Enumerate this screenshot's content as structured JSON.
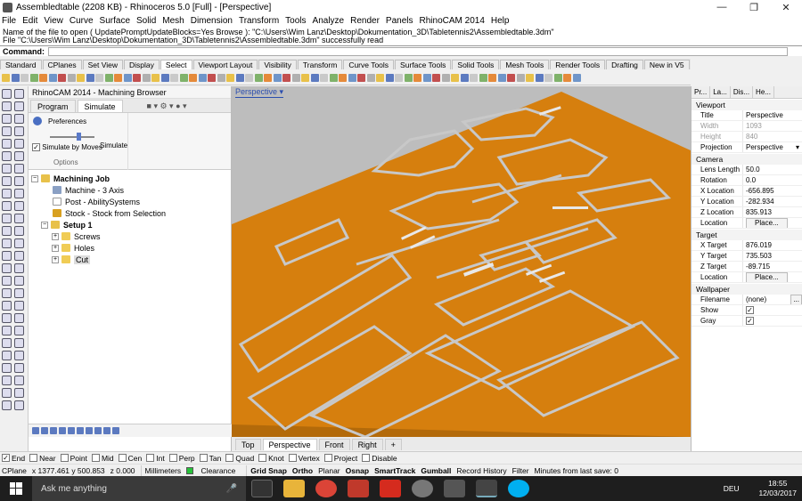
{
  "window": {
    "title": "Assembledtable (2208 KB) - Rhinoceros 5.0 [Full] - [Perspective]"
  },
  "menu": [
    "File",
    "Edit",
    "View",
    "Curve",
    "Surface",
    "Solid",
    "Mesh",
    "Dimension",
    "Transform",
    "Tools",
    "Analyze",
    "Render",
    "Panels",
    "RhinoCAM 2014",
    "Help"
  ],
  "command_history": [
    "Name of the file to open ( UpdatePromptUpdateBlocks=Yes  Browse ): \"C:\\Users\\Wim Lanz\\Desktop\\Dokumentation_3D\\Tabletennis2\\Assembledtable.3dm\"",
    "File \"C:\\Users\\Wim Lanz\\Desktop\\Dokumentation_3D\\Tabletennis2\\Assembledtable.3dm\" successfully read"
  ],
  "command_label": "Command:",
  "toolbar_tabs": [
    "Standard",
    "CPlanes",
    "Set View",
    "Display",
    "Select",
    "Viewport Layout",
    "Visibility",
    "Transform",
    "Curve Tools",
    "Surface Tools",
    "Solid Tools",
    "Mesh Tools",
    "Render Tools",
    "Drafting",
    "New in V5"
  ],
  "active_toolbar_tab": "Select",
  "browser": {
    "title": "RhinoCAM 2014 - Machining Browser",
    "tabs": [
      "Program",
      "Simulate"
    ],
    "preferences_label": "Preferences",
    "simulate_by_moves": "Simulate by Moves",
    "options_label": "Options",
    "simulate_label": "Simulate",
    "tree": {
      "job": "Machining Job",
      "machine": "Machine - 3 Axis",
      "post": "Post - AbilitySystems",
      "stock": "Stock - Stock from Selection",
      "setup": "Setup 1",
      "folders": [
        "Screws",
        "Holes",
        "Cut"
      ]
    }
  },
  "viewport": {
    "label": "Perspective",
    "tabs": [
      "Top",
      "Perspective",
      "Front",
      "Right",
      "+"
    ],
    "active_tab": "Perspective"
  },
  "properties": {
    "tabs": [
      "Pr...",
      "La...",
      "Dis...",
      "He..."
    ],
    "viewport_section": "Viewport",
    "title_label": "Title",
    "title_value": "Perspective",
    "width_label": "Width",
    "width_value": "1093",
    "height_label": "Height",
    "height_value": "840",
    "projection_label": "Projection",
    "projection_value": "Perspective",
    "camera_section": "Camera",
    "lens_label": "Lens Length",
    "lens_value": "50.0",
    "rotation_label": "Rotation",
    "rotation_value": "0.0",
    "xloc_label": "X Location",
    "xloc_value": "-656.895",
    "yloc_label": "Y Location",
    "yloc_value": "-282.934",
    "zloc_label": "Z Location",
    "zloc_value": "835.913",
    "location_label": "Location",
    "place_label": "Place...",
    "target_section": "Target",
    "xt_label": "X Target",
    "xt_value": "876.019",
    "yt_label": "Y Target",
    "yt_value": "735.503",
    "zt_label": "Z Target",
    "zt_value": "-89.715",
    "target_location_label": "Location",
    "target_place_label": "Place...",
    "wallpaper_section": "Wallpaper",
    "filename_label": "Filename",
    "filename_value": "(none)",
    "show_label": "Show",
    "gray_label": "Gray",
    "more_label": "..."
  },
  "osnaps": [
    {
      "label": "End",
      "checked": true
    },
    {
      "label": "Near",
      "checked": false
    },
    {
      "label": "Point",
      "checked": false
    },
    {
      "label": "Mid",
      "checked": false
    },
    {
      "label": "Cen",
      "checked": false
    },
    {
      "label": "Int",
      "checked": false
    },
    {
      "label": "Perp",
      "checked": false
    },
    {
      "label": "Tan",
      "checked": false
    },
    {
      "label": "Quad",
      "checked": false
    },
    {
      "label": "Knot",
      "checked": false
    },
    {
      "label": "Vertex",
      "checked": false
    },
    {
      "label": "Project",
      "checked": false
    },
    {
      "label": "Disable",
      "checked": false
    }
  ],
  "status": {
    "cplane": "CPlane",
    "coords": "x 1377.461  y 500.853",
    "z": "z 0.000",
    "units": "Millimeters",
    "layer": "Clearance",
    "items": [
      "Grid Snap",
      "Ortho",
      "Planar",
      "Osnap",
      "SmartTrack",
      "Gumball",
      "Record History",
      "Filter"
    ],
    "last_save": "Minutes from last save: 0"
  },
  "taskbar": {
    "search_placeholder": "Ask me anything",
    "language": "DEU",
    "time": "18:55",
    "date": "12/03/2017"
  },
  "colors": {
    "accent": "#2b4eae",
    "stock": "#d67f0e",
    "taskbar": "#1e1e1e"
  }
}
